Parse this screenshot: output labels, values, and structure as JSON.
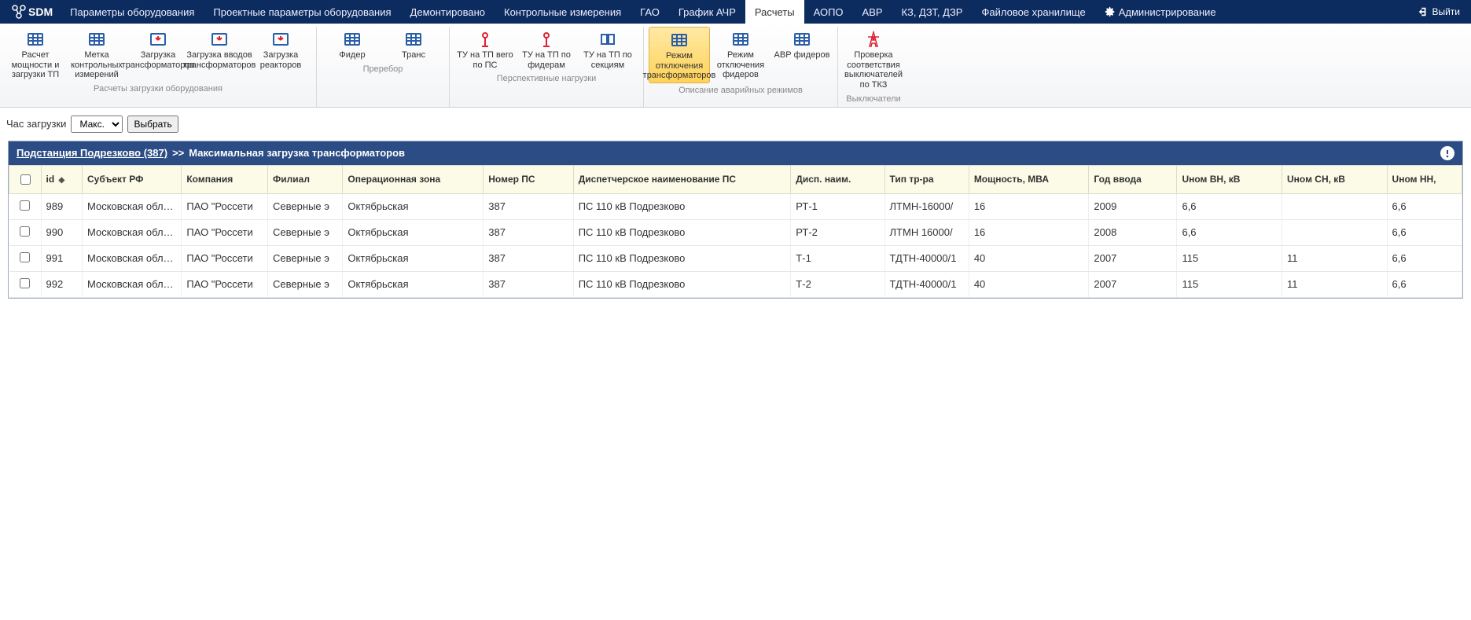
{
  "app": {
    "name": "SDM",
    "exit": "Выйти"
  },
  "nav": {
    "items": [
      "Параметры оборудования",
      "Проектные параметры оборудования",
      "Демонтировано",
      "Контрольные измерения",
      "ГАО",
      "График АЧР",
      "Расчеты",
      "АОПО",
      "АВР",
      "КЗ, ДЗТ, ДЗР",
      "Файловое хранилище",
      "Администрирование"
    ],
    "active_index": 6
  },
  "ribbon": {
    "group1": {
      "label": "Расчеты загрузки оборудования",
      "items": [
        "Расчет мощности и загрузки ТП",
        "Метка контрольных измерений",
        "Загрузка трансформаторов",
        "Загрузка вводов трансформаторов",
        "Загрузка реакторов"
      ]
    },
    "group2": {
      "label": "Преребор",
      "items": [
        "Фидер",
        "Транс"
      ]
    },
    "group3": {
      "label": "Перспективные нагрузки",
      "items": [
        "ТУ на ТП вего по ПС",
        "ТУ на ТП по фидерам",
        "ТУ на ТП по секциям"
      ]
    },
    "group4": {
      "label": "Описание аварийных режимов",
      "items": [
        "Режим отключения трансформаторов",
        "Режим отключения фидеров",
        "АВР фидеров"
      ],
      "active_index": 0
    },
    "group5": {
      "label": "Выключатели",
      "items": [
        "Проверка соответствия выключателей по ТКЗ"
      ]
    }
  },
  "filter": {
    "label": "Час загрузки",
    "select_value": "Макс.",
    "options": [
      "Макс."
    ],
    "choose_btn": "Выбрать"
  },
  "grid": {
    "crumb_link": "Подстанция Подрезково (387)",
    "crumb_sep": ">>",
    "crumb_title": "Максимальная загрузка трансформаторов",
    "columns": [
      "",
      "id",
      "Субъект РФ",
      "Компания",
      "Филиал",
      "Операционная зона",
      "Номер ПС",
      "Диспетчерское наименование ПС",
      "Дисп. наим.",
      "Тип тр-ра",
      "Мощность, МВА",
      "Год ввода",
      "Uном ВН, кВ",
      "Uном СН, кВ",
      "Uном НН,"
    ],
    "rows": [
      {
        "id": "989",
        "subj": "Московская область",
        "comp": "ПАО \"Россети",
        "fil": "Северные э",
        "op": "Октябрьская",
        "num": "387",
        "disp": "ПС 110 кВ Подрезково",
        "dname": "РТ-1",
        "type": "ЛТМН-16000/",
        "pow": "16",
        "year": "2009",
        "uvn": "6,6",
        "usn": "",
        "unn": "6,6"
      },
      {
        "id": "990",
        "subj": "Московская область",
        "comp": "ПАО \"Россети",
        "fil": "Северные э",
        "op": "Октябрьская",
        "num": "387",
        "disp": "ПС 110 кВ Подрезково",
        "dname": "РТ-2",
        "type": "ЛТМН 16000/",
        "pow": "16",
        "year": "2008",
        "uvn": "6,6",
        "usn": "",
        "unn": "6,6"
      },
      {
        "id": "991",
        "subj": "Московская область",
        "comp": "ПАО \"Россети",
        "fil": "Северные э",
        "op": "Октябрьская",
        "num": "387",
        "disp": "ПС 110 кВ Подрезково",
        "dname": "Т-1",
        "type": "ТДТН-40000/1",
        "pow": "40",
        "year": "2007",
        "uvn": "115",
        "usn": "11",
        "unn": "6,6"
      },
      {
        "id": "992",
        "subj": "Московская область",
        "comp": "ПАО \"Россети",
        "fil": "Северные э",
        "op": "Октябрьская",
        "num": "387",
        "disp": "ПС 110 кВ Подрезково",
        "dname": "Т-2",
        "type": "ТДТН-40000/1",
        "pow": "40",
        "year": "2007",
        "uvn": "115",
        "usn": "11",
        "unn": "6,6"
      }
    ]
  }
}
